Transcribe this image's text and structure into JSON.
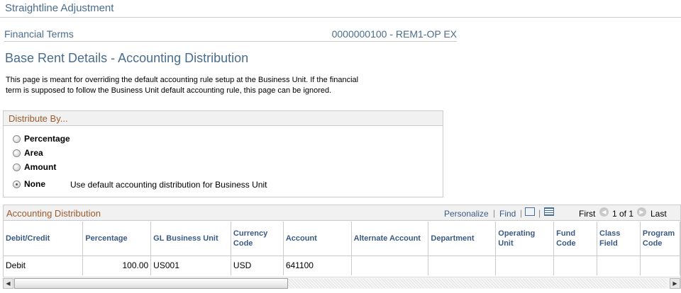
{
  "header": {
    "title": "Straightline Adjustment"
  },
  "financial_terms": {
    "label": "Financial Terms",
    "value": "0000000100 - REM1-OP EX"
  },
  "section": {
    "title": "Base Rent Details - Accounting Distribution",
    "info": "This page is meant for overriding the default accounting rule setup at the Business Unit. If the financial term is supposed to follow the Business Unit default accounting rule, this page can be ignored."
  },
  "distribute_by": {
    "title": "Distribute By...",
    "options": [
      {
        "label": "Percentage",
        "checked": false
      },
      {
        "label": "Area",
        "checked": false
      },
      {
        "label": "Amount",
        "checked": false
      },
      {
        "label": "None",
        "checked": true
      }
    ],
    "none_description": "Use default accounting distribution for Business Unit"
  },
  "grid": {
    "title": "Accounting Distribution",
    "personalize": "Personalize",
    "find": "Find",
    "separator": "|",
    "first": "First",
    "page_info": "1 of 1",
    "last": "Last",
    "columns": [
      "Debit/Credit",
      "Percentage",
      "GL Business Unit",
      "Currency Code",
      "Account",
      "Alternate Account",
      "Department",
      "Operating Unit",
      "Fund Code",
      "Class Field",
      "Program Code"
    ],
    "rows": [
      [
        "Debit",
        "100.00",
        "US001",
        "USD",
        "641100",
        "",
        "",
        "",
        "",
        "",
        ""
      ]
    ]
  }
}
